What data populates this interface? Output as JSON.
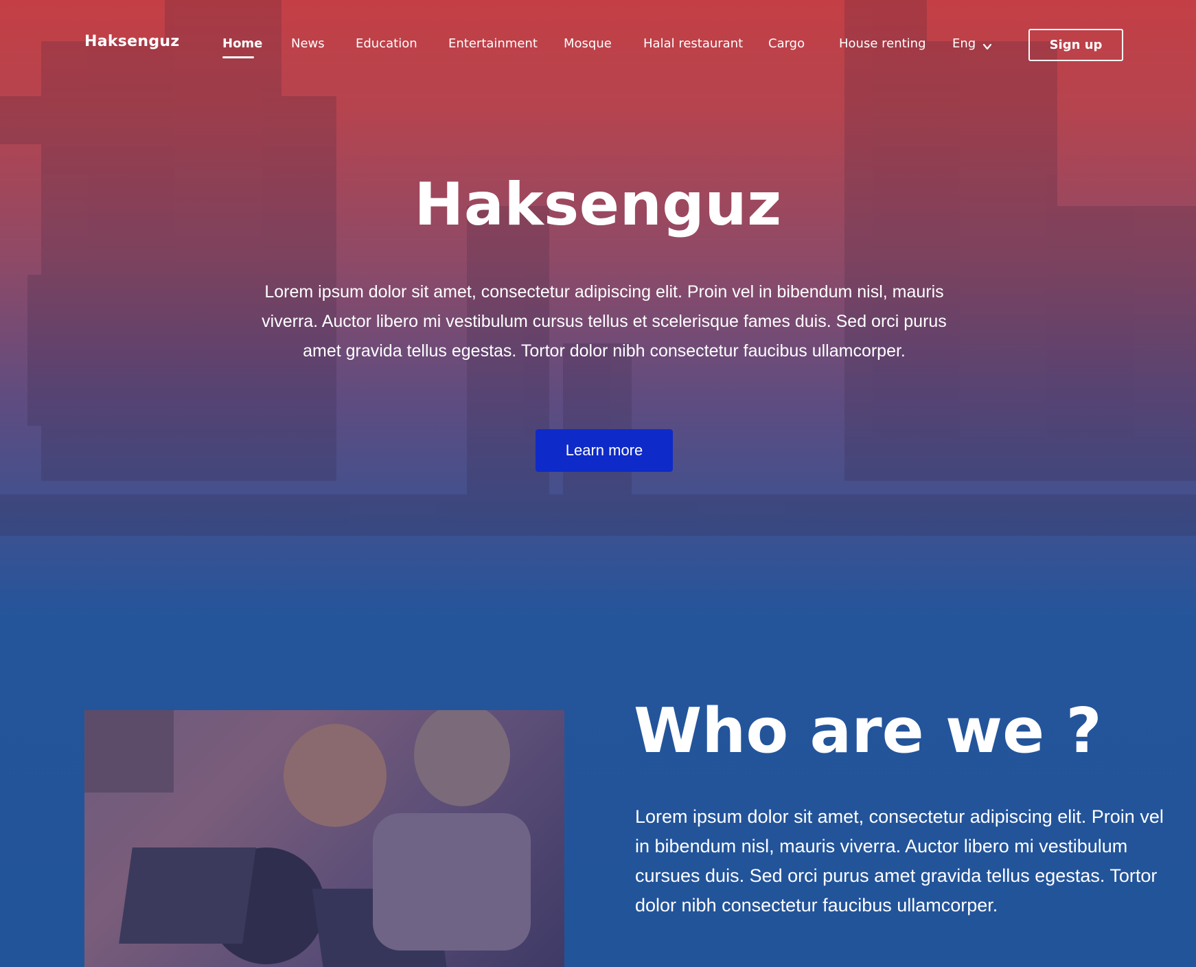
{
  "nav": {
    "brand": "Haksenguz",
    "links": [
      "Home",
      "News",
      "Education",
      "Entertainment",
      "Mosque",
      "Halal restaurant",
      "Cargo",
      "House renting"
    ],
    "active": "Home",
    "language": "Eng",
    "signup_label": "Sign up"
  },
  "hero": {
    "title": "Haksenguz",
    "text": "Lorem ipsum dolor sit amet, consectetur adipiscing elit.  Proin vel in bibendum nisl, mauris viverra.  Auctor libero mi vestibulum cursus tellus et scelerisque fames duis.  Sed orci purus amet gravida tellus egestas.  Tortor dolor nibh consectetur faucibus ullamcorper.",
    "button_label": "Learn more"
  },
  "about": {
    "title": "Who are we ?",
    "text": "Lorem ipsum dolor sit amet, consectetur adipiscing elit.  Proin vel in bibendum nisl, mauris viverra.  Auctor libero mi vestibulum cursues duis.  Sed orci purus amet gravida tellus egestas.  Tortor dolor nibh consectetur faucibus ullamcorper."
  },
  "colors": {
    "hero_top": "#c43f45",
    "section_blue": "#22549a",
    "button_blue": "#0e2ac8"
  }
}
